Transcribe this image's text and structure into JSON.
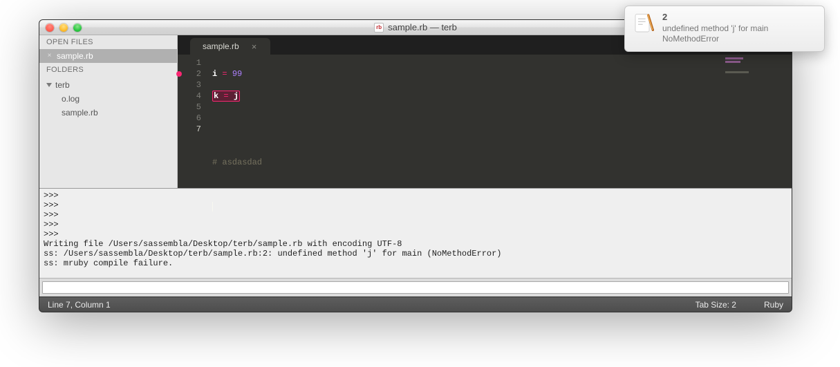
{
  "titlebar": {
    "file_icon_text": "rb",
    "title": "sample.rb — terb"
  },
  "sidebar": {
    "open_files_header": "OPEN FILES",
    "open_files": [
      {
        "name": "sample.rb"
      }
    ],
    "folders_header": "FOLDERS",
    "root_folder": "terb",
    "files": [
      {
        "name": "o.log"
      },
      {
        "name": "sample.rb"
      }
    ]
  },
  "tab": {
    "label": "sample.rb"
  },
  "code": {
    "lines": [
      {
        "n": "1",
        "current": false,
        "dot": false
      },
      {
        "n": "2",
        "current": false,
        "dot": true
      },
      {
        "n": "3",
        "current": false,
        "dot": false
      },
      {
        "n": "4",
        "current": false,
        "dot": false
      },
      {
        "n": "5",
        "current": false,
        "dot": false
      },
      {
        "n": "6",
        "current": false,
        "dot": false
      },
      {
        "n": "7",
        "current": true,
        "dot": false
      }
    ],
    "l1_var": "i",
    "l1_op": "=",
    "l1_num": "99",
    "l2_var": "k",
    "l2_op": "=",
    "l2_rhs": "j",
    "l5_comment": "# asdasdad"
  },
  "console_text": ">>>\n>>>\n>>>\n>>>\n>>>\nWriting file /Users/sassembla/Desktop/terb/sample.rb with encoding UTF-8\nss: /Users/sassembla/Desktop/terb/sample.rb:2: undefined method 'j' for main (NoMethodError)\nss: mruby compile failure.",
  "statusbar": {
    "left": "Line 7, Column 1",
    "tab_size": "Tab Size: 2",
    "syntax": "Ruby"
  },
  "notification": {
    "title": "2",
    "line1": "undefined method 'j' for main",
    "line2": "NoMethodError"
  }
}
